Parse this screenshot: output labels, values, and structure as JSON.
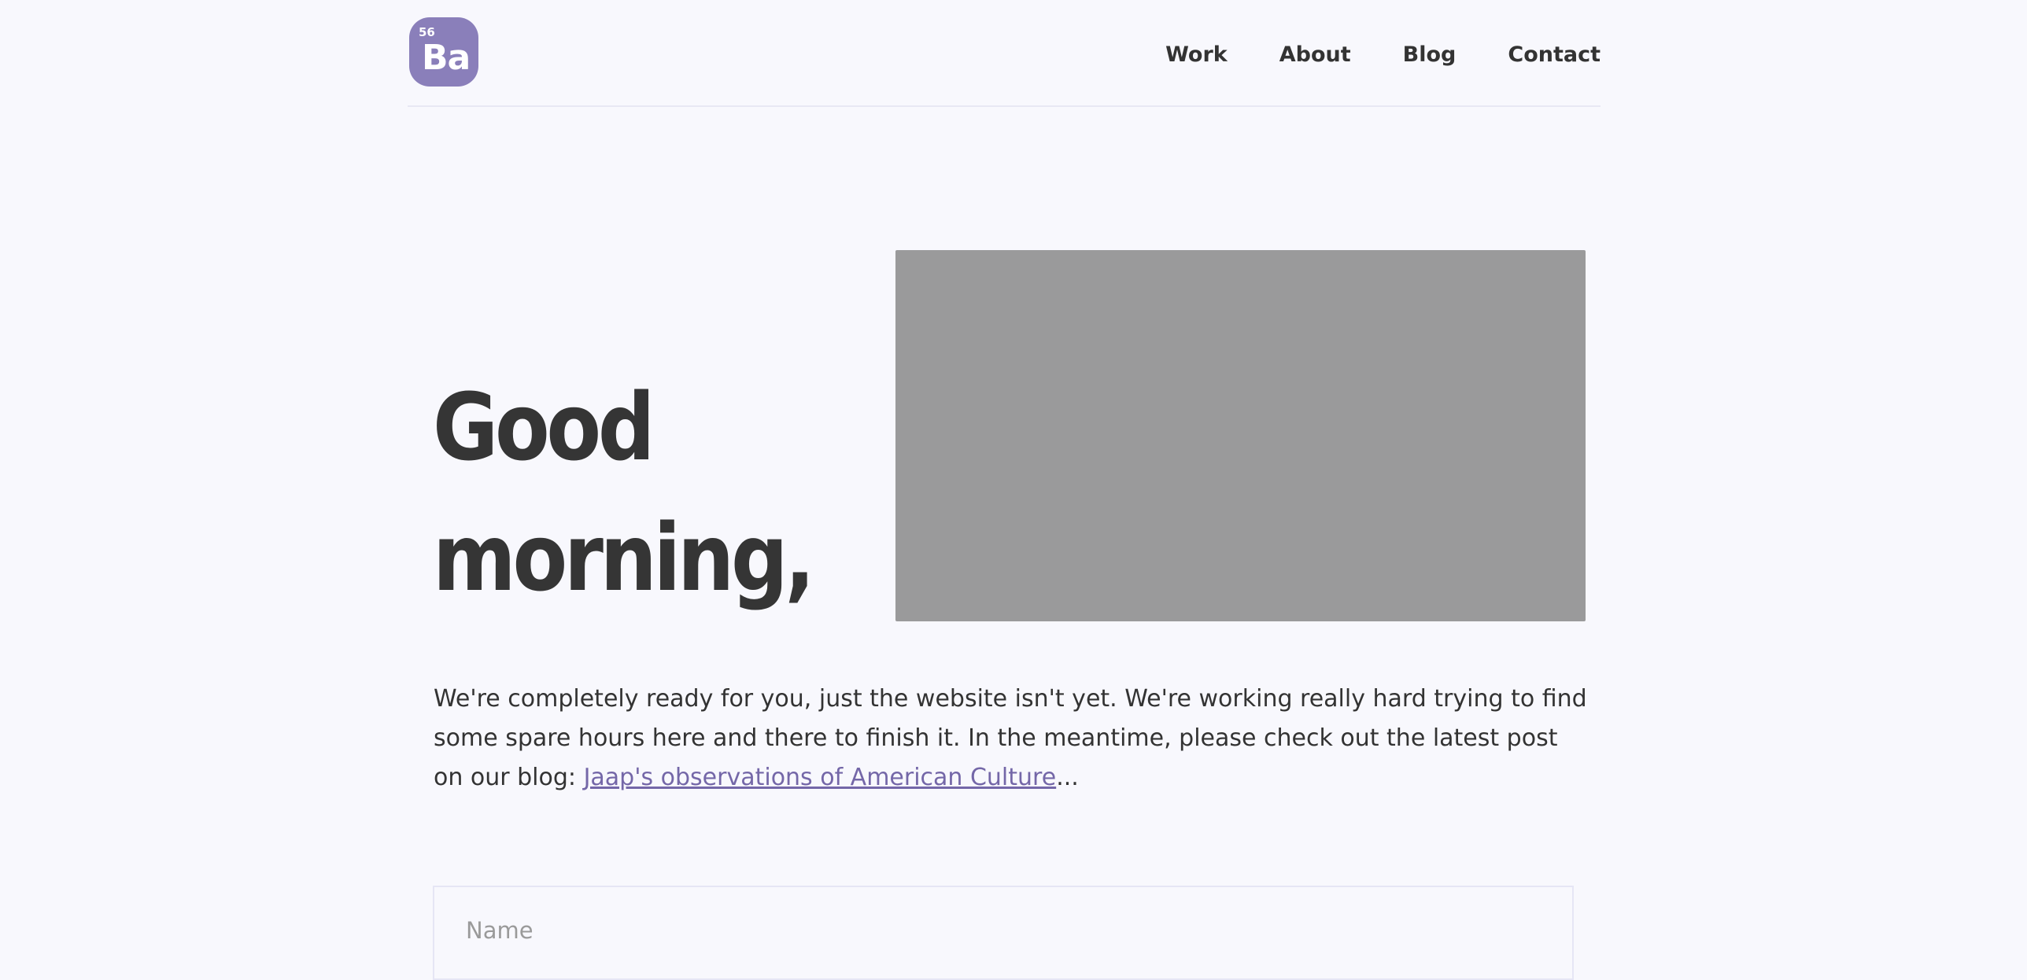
{
  "logo": {
    "number": "56",
    "symbol": "Ba"
  },
  "nav": {
    "items": [
      {
        "label": "Work"
      },
      {
        "label": "About"
      },
      {
        "label": "Blog"
      },
      {
        "label": "Contact"
      }
    ]
  },
  "hero": {
    "title_line1": "Good",
    "title_line2": "morning,"
  },
  "intro": {
    "text_before_link": "We're completely ready for you, just the website isn't yet. We're working really hard trying to find some spare hours here and there to finish it. In the meantime, please check out the latest post on our blog: ",
    "link_text": "Jaap's observations of American Culture",
    "text_after_link": "..."
  },
  "form": {
    "name_placeholder": "Name"
  },
  "colors": {
    "background": "#f8f8fd",
    "logo": "#8a7fba",
    "link": "#7467a8",
    "image_placeholder": "#9a9a9b",
    "text": "#333333"
  }
}
